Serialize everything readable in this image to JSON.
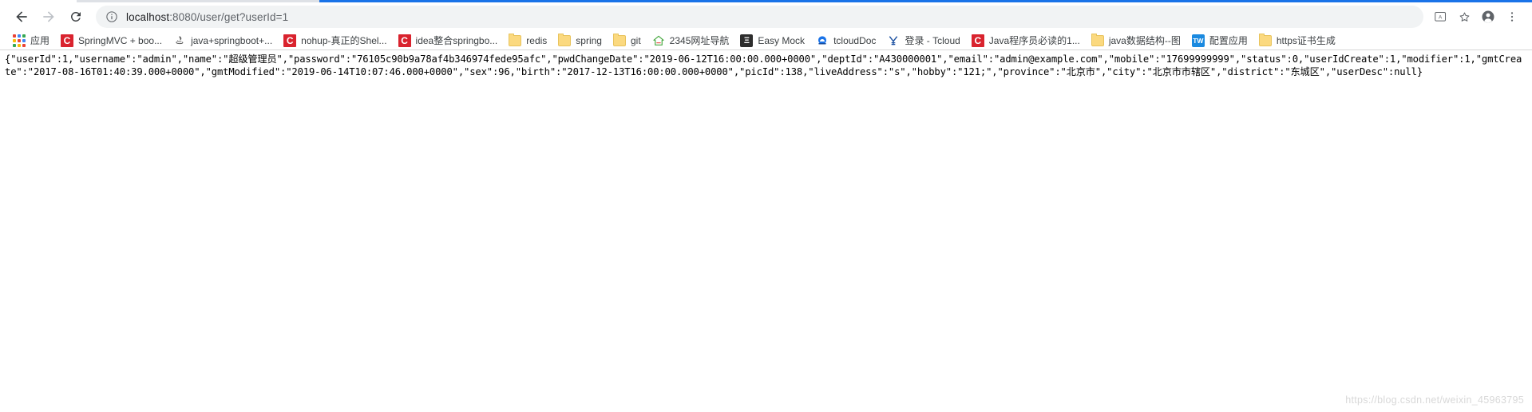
{
  "browser": {
    "nav": {
      "back": "back-arrow",
      "forward": "forward-arrow",
      "reload": "reload"
    },
    "omnibox": {
      "info_icon": "info-circle-icon",
      "url_host": "localhost",
      "url_path": ":8080/user/get?userId=1",
      "url_full": "localhost:8080/user/get?userId=1"
    },
    "toolbar_right": [
      {
        "name": "translate-icon",
        "glyph": "文"
      },
      {
        "name": "bookmark-star-icon",
        "glyph": "☆"
      },
      {
        "name": "profile-avatar-icon",
        "glyph": "●"
      },
      {
        "name": "chrome-menu-icon",
        "glyph": "⋮"
      }
    ]
  },
  "bookmarks": [
    {
      "label": "应用",
      "icon": "apps-grid-icon",
      "type": "apps"
    },
    {
      "label": "SpringMVC + boo...",
      "icon": "csdn-icon",
      "type": "c",
      "color": "#d9232e"
    },
    {
      "label": "java+springboot+...",
      "icon": "site-icon",
      "type": "glyph",
      "glyph": "☸",
      "color": "#ffffff",
      "fg": "#5a5a5a"
    },
    {
      "label": "nohup-真正的Shel...",
      "icon": "csdn-icon",
      "type": "c",
      "color": "#d9232e"
    },
    {
      "label": "idea整合springbo...",
      "icon": "csdn-icon",
      "type": "c",
      "color": "#d9232e"
    },
    {
      "label": "redis",
      "icon": "folder-icon",
      "type": "folder"
    },
    {
      "label": "spring",
      "icon": "folder-icon",
      "type": "folder"
    },
    {
      "label": "git",
      "icon": "folder-icon",
      "type": "folder"
    },
    {
      "label": "2345网址导航",
      "icon": "house-icon",
      "type": "glyph",
      "glyph": "⌂",
      "color": "#ffffff",
      "fg": "#49a942"
    },
    {
      "label": "Easy Mock",
      "icon": "easymock-icon",
      "type": "glyph",
      "glyph": "Ξ",
      "color": "#2d2d2d",
      "fg": "#ffffff"
    },
    {
      "label": "tcloudDoc",
      "icon": "tcloud-icon",
      "type": "glyph",
      "glyph": "☁",
      "color": "#ffffff",
      "fg": "#1a73e8"
    },
    {
      "label": "登录 - Tcloud",
      "icon": "tcloud-login-icon",
      "type": "glyph",
      "glyph": "¥",
      "color": "#ffffff",
      "fg": "#1a4fa0"
    },
    {
      "label": "Java程序员必读的1...",
      "icon": "csdn-icon",
      "type": "c",
      "color": "#d9232e"
    },
    {
      "label": "java数据结构--图",
      "icon": "folder-icon",
      "type": "folder"
    },
    {
      "label": "配置应用",
      "icon": "tw-icon",
      "type": "glyph",
      "glyph": "TW",
      "color": "#1b8ae0",
      "fg": "#ffffff"
    },
    {
      "label": "https证书生成",
      "icon": "folder-icon",
      "type": "folder"
    }
  ],
  "content": {
    "json_response": "{\"userId\":1,\"username\":\"admin\",\"name\":\"超级管理员\",\"password\":\"76105c90b9a78af4b346974fede95afc\",\"pwdChangeDate\":\"2019-06-12T16:00:00.000+0000\",\"deptId\":\"A430000001\",\"email\":\"admin@example.com\",\"mobile\":\"17699999999\",\"status\":0,\"userIdCreate\":1,\"modifier\":1,\"gmtCreate\":\"2017-08-16T01:40:39.000+0000\",\"gmtModified\":\"2019-06-14T10:07:46.000+0000\",\"sex\":96,\"birth\":\"2017-12-13T16:00:00.000+0000\",\"picId\":138,\"liveAddress\":\"s\",\"hobby\":\"121;\",\"province\":\"北京市\",\"city\":\"北京市市辖区\",\"district\":\"东城区\",\"userDesc\":null}"
  },
  "watermark": {
    "text": "https://blog.csdn.net/weixin_45963795"
  }
}
